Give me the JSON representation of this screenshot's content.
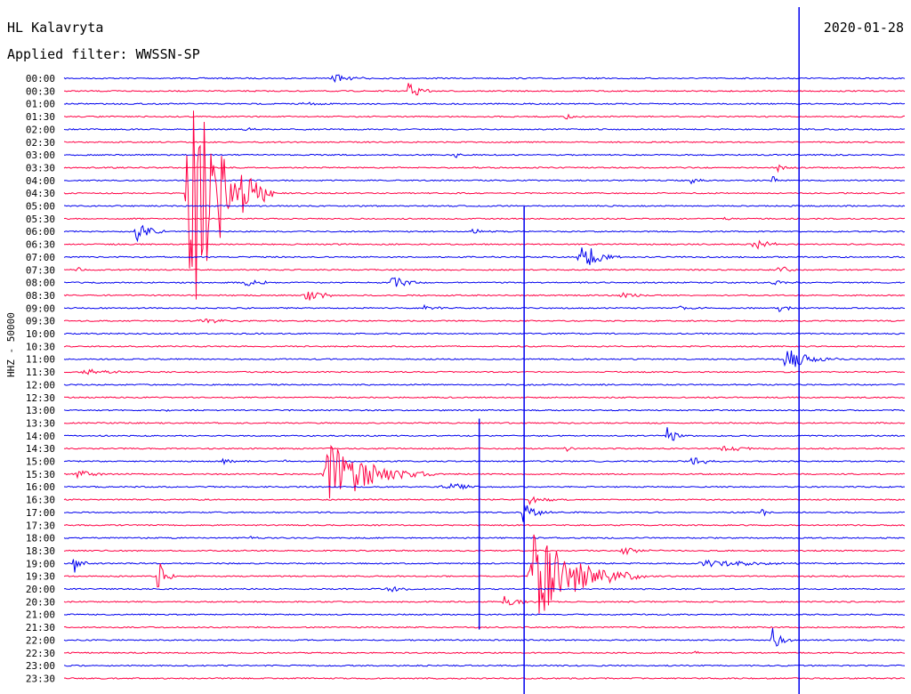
{
  "header": {
    "station": "HL Kalavryta",
    "filter": "Applied filter: WWSSN-SP",
    "date": "2020-01-28",
    "channel_label": "HHZ - 50000"
  },
  "colors": {
    "trace_a": "#0000ee",
    "trace_b": "#ff0044"
  },
  "chart_data": {
    "type": "line",
    "title": "HL Kalavryta",
    "subtitle": "Applied filter: WWSSN-SP",
    "ylabel": "HHZ - 50000",
    "rows": [
      "00:00",
      "00:30",
      "01:00",
      "01:30",
      "02:00",
      "02:30",
      "03:00",
      "03:30",
      "04:00",
      "04:30",
      "05:00",
      "05:30",
      "06:00",
      "06:30",
      "07:00",
      "07:30",
      "08:00",
      "08:30",
      "09:00",
      "09:30",
      "10:00",
      "10:30",
      "11:00",
      "11:30",
      "12:00",
      "12:30",
      "13:00",
      "13:30",
      "14:00",
      "14:30",
      "15:00",
      "15:30",
      "16:00",
      "16:30",
      "17:00",
      "17:30",
      "18:00",
      "18:30",
      "19:00",
      "19:30",
      "20:00",
      "20:30",
      "21:00",
      "21:30",
      "22:00",
      "22:30",
      "23:00",
      "23:30"
    ],
    "minutes_per_row": 30,
    "events": [
      {
        "row": 0,
        "minute": 9.5,
        "amp": 5,
        "dur": 1.6
      },
      {
        "row": 1,
        "minute": 12.2,
        "amp": 10,
        "dur": 1.2
      },
      {
        "row": 2,
        "minute": 8.4,
        "amp": 2,
        "dur": 2
      },
      {
        "row": 3,
        "minute": 17.8,
        "amp": 3,
        "dur": 1.2
      },
      {
        "row": 4,
        "minute": 6.4,
        "amp": 2,
        "dur": 1.2
      },
      {
        "row": 6,
        "minute": 13.9,
        "amp": 4,
        "dur": 0.4
      },
      {
        "row": 6,
        "minute": 24.4,
        "amp": 3,
        "dur": 0.3
      },
      {
        "row": 7,
        "minute": 25.4,
        "amp": 8,
        "dur": 0.6
      },
      {
        "row": 8,
        "minute": 22.3,
        "amp": 4,
        "dur": 1
      },
      {
        "row": 8,
        "minute": 25.2,
        "amp": 12,
        "dur": 0.3
      },
      {
        "row": 9,
        "minute": 4.3,
        "amp": 150,
        "dur": 3.2
      },
      {
        "row": 11,
        "minute": 23.5,
        "amp": 3,
        "dur": 0.8
      },
      {
        "row": 12,
        "minute": 2.5,
        "amp": 14,
        "dur": 1.4
      },
      {
        "row": 12,
        "minute": 14.5,
        "amp": 3,
        "dur": 1
      },
      {
        "row": 13,
        "minute": 24.5,
        "amp": 9,
        "dur": 1.2
      },
      {
        "row": 14,
        "minute": 18.3,
        "amp": 22,
        "dur": 1.6
      },
      {
        "row": 15,
        "minute": 0.4,
        "amp": 4,
        "dur": 0.6
      },
      {
        "row": 15,
        "minute": 25.4,
        "amp": 6,
        "dur": 1
      },
      {
        "row": 16,
        "minute": 6.4,
        "amp": 5,
        "dur": 1.4
      },
      {
        "row": 16,
        "minute": 11.6,
        "amp": 9,
        "dur": 1.4
      },
      {
        "row": 16,
        "minute": 25.2,
        "amp": 4,
        "dur": 1.2
      },
      {
        "row": 17,
        "minute": 8.5,
        "amp": 6,
        "dur": 2
      },
      {
        "row": 17,
        "minute": 19.8,
        "amp": 4,
        "dur": 1.4
      },
      {
        "row": 18,
        "minute": 12.7,
        "amp": 3,
        "dur": 1.6
      },
      {
        "row": 18,
        "minute": 21.8,
        "amp": 3,
        "dur": 1.6
      },
      {
        "row": 18,
        "minute": 25.4,
        "amp": 5,
        "dur": 1
      },
      {
        "row": 19,
        "minute": 4.7,
        "amp": 4,
        "dur": 2
      },
      {
        "row": 22,
        "minute": 25.6,
        "amp": 20,
        "dur": 2
      },
      {
        "row": 23,
        "minute": 0.6,
        "amp": 4,
        "dur": 2
      },
      {
        "row": 26,
        "minute": 3.6,
        "amp": 3,
        "dur": 0.3
      },
      {
        "row": 28,
        "minute": 21.4,
        "amp": 15,
        "dur": 0.8
      },
      {
        "row": 29,
        "minute": 17.8,
        "amp": 5,
        "dur": 1
      },
      {
        "row": 29,
        "minute": 23.4,
        "amp": 4,
        "dur": 2
      },
      {
        "row": 30,
        "minute": 5.6,
        "amp": 4,
        "dur": 1.2
      },
      {
        "row": 30,
        "minute": 7.8,
        "amp": 3,
        "dur": 0.6
      },
      {
        "row": 30,
        "minute": 22.3,
        "amp": 6,
        "dur": 1.4
      },
      {
        "row": 31,
        "minute": 0.4,
        "amp": 5,
        "dur": 1.4
      },
      {
        "row": 31,
        "minute": 9.2,
        "amp": 40,
        "dur": 4
      },
      {
        "row": 32,
        "minute": 13.4,
        "amp": 6,
        "dur": 2
      },
      {
        "row": 33,
        "minute": 16.5,
        "amp": 5,
        "dur": 1.6
      },
      {
        "row": 34,
        "minute": 16.3,
        "amp": 12,
        "dur": 1.2
      },
      {
        "row": 34,
        "minute": 24.8,
        "amp": 5,
        "dur": 0.8
      },
      {
        "row": 36,
        "minute": 6.6,
        "amp": 3,
        "dur": 0.4
      },
      {
        "row": 37,
        "minute": 19.8,
        "amp": 4,
        "dur": 2
      },
      {
        "row": 38,
        "minute": 0.3,
        "amp": 14,
        "dur": 0.6
      },
      {
        "row": 38,
        "minute": 22.5,
        "amp": 4,
        "dur": 6
      },
      {
        "row": 39,
        "minute": 3.3,
        "amp": 20,
        "dur": 0.8
      },
      {
        "row": 39,
        "minute": 16.5,
        "amp": 52,
        "dur": 4.2
      },
      {
        "row": 40,
        "minute": 11.4,
        "amp": 4,
        "dur": 2
      },
      {
        "row": 41,
        "minute": 15.6,
        "amp": 6,
        "dur": 1.6
      },
      {
        "row": 44,
        "minute": 25.2,
        "amp": 16,
        "dur": 0.8
      },
      {
        "row": 45,
        "minute": 22.4,
        "amp": 3,
        "dur": 0.8
      }
    ],
    "spikes": [
      {
        "row": 11,
        "minute": 16.4,
        "amp_up": 14,
        "amp_down": 540
      },
      {
        "row": 27,
        "minute": 14.8,
        "amp_up": 5,
        "amp_down": 232
      },
      {
        "row": 0,
        "minute": 26.2,
        "amp_up": 80,
        "amp_down": 700
      }
    ]
  }
}
